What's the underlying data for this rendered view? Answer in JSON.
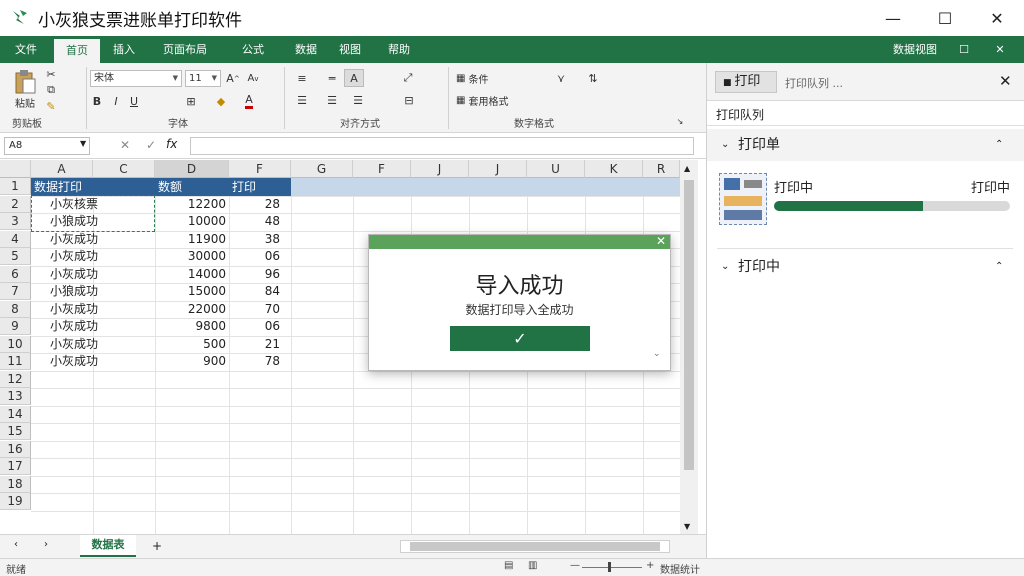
{
  "window": {
    "title": "小灰狼支票进账单打印软件",
    "minimize_glyph": "—",
    "maximize_glyph": "☐",
    "close_glyph": "✕"
  },
  "menu": {
    "tabs": [
      "文件",
      "首页",
      "插入",
      "页面布局",
      "公式",
      "数据",
      "视图",
      "帮助"
    ],
    "active_index": 1,
    "right_label": "数据视图",
    "right_icons": [
      "restore-icon",
      "close-icon"
    ]
  },
  "ribbon": {
    "clipboard": {
      "paste_label": "粘贴",
      "group_label": "剪贴板"
    },
    "font": {
      "font_name": "宋体",
      "font_size": "11",
      "bold": "B",
      "italic": "I",
      "underline": "U",
      "group_label": "字体"
    },
    "alignment": {
      "group_label": "对齐方式"
    },
    "number": {
      "cond_label": "条件",
      "format_label": "套用格式",
      "group_label": "数字格式"
    }
  },
  "formula_bar": {
    "name_box": "A8",
    "cancel_glyph": "✕",
    "enter_glyph": "✓",
    "fx_glyph": "fx",
    "value": ""
  },
  "sheet": {
    "column_headers": [
      "A",
      "C",
      "D",
      "F",
      "G",
      "F",
      "J",
      "J",
      "U",
      "K",
      "R"
    ],
    "selected_column": "D",
    "row_headers": [
      "1",
      "2",
      "3",
      "4",
      "5",
      "6",
      "7",
      "8",
      "9",
      "10",
      "11",
      "12",
      "13",
      "14",
      "15",
      "16",
      "17",
      "18",
      "19"
    ],
    "header_cells": [
      "数据打印",
      "数额",
      "打印"
    ],
    "rows": [
      [
        "小灰核票",
        "12200",
        "28"
      ],
      [
        "小狼成功",
        "10000",
        "48"
      ],
      [
        "小灰成功",
        "11900",
        "38"
      ],
      [
        "小灰成功",
        "30000",
        "06"
      ],
      [
        "小灰成功",
        "14000",
        "96"
      ],
      [
        "小狼成功",
        "15000",
        "84"
      ],
      [
        "小灰成功",
        "22000",
        "70"
      ],
      [
        "小灰成功",
        "9800",
        "06"
      ],
      [
        "小灰成功",
        "500",
        "21"
      ],
      [
        "小灰成功",
        "900",
        "78"
      ]
    ],
    "tab_label": "数据表"
  },
  "statusbar": {
    "left_text": "就绪",
    "right_text": "数据统计",
    "zoom_minus": "—",
    "zoom_plus": "+"
  },
  "pane": {
    "tab_label": "打印",
    "tab_label_2": "打印队列 ...",
    "subtitle": "打印队列",
    "section1_title": "打印单",
    "job_title": "打印中",
    "job_status": "打印中",
    "job_progress": 0.63,
    "section2_title": "打印中"
  },
  "dialog": {
    "title": "导入成功",
    "message": "数据打印导入全成功",
    "ok_glyph": "✓",
    "colors": {
      "bar": "#5ba35a",
      "button": "#217346"
    }
  },
  "colors": {
    "accent": "#217346",
    "header_fill": "#2e5f94"
  }
}
